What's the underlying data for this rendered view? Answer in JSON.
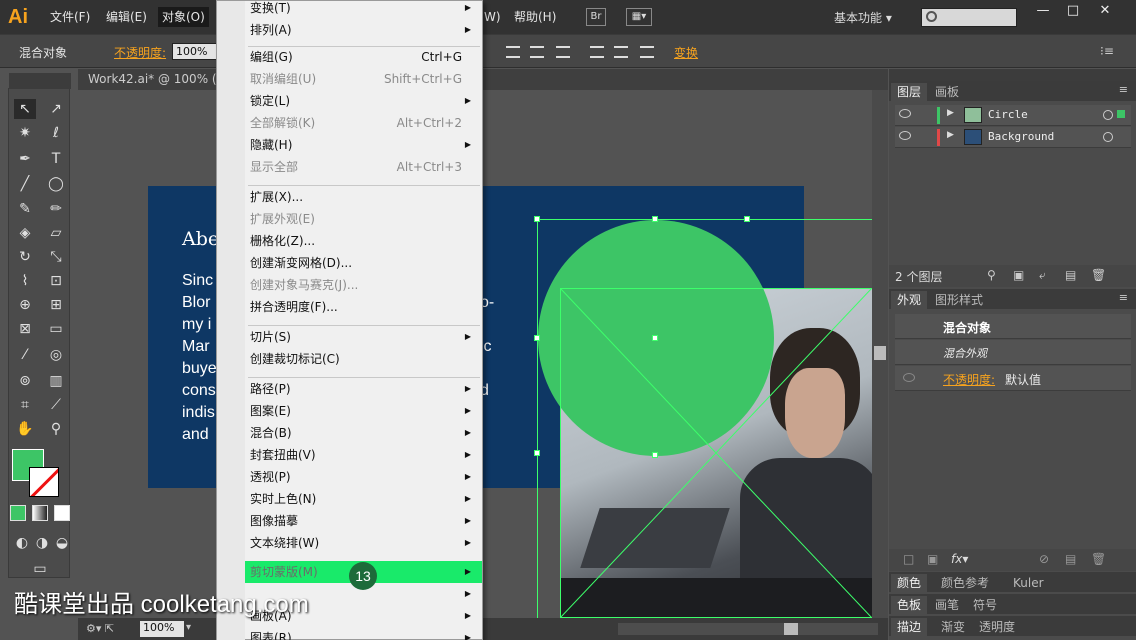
{
  "app": {
    "logo": "Ai",
    "menus": [
      "文件(F)",
      "编辑(E)",
      "对象(O)",
      "W)",
      "帮助(H)"
    ],
    "bridge": "Br",
    "workspace": "基本功能",
    "win_min": "—",
    "win_max": "□",
    "win_close": "✕"
  },
  "control": {
    "label": "混合对象",
    "opacity_label": "不透明度:",
    "opacity_value": "100%",
    "transform": "变换"
  },
  "document": {
    "tab": "Work42.ai* @ 100% (",
    "heading": "Abe",
    "lines_left": [
      "Sinc",
      "Blor",
      "my i",
      "Mar",
      "buye",
      "cons",
      "indis",
      "and"
    ],
    "lines_right": [
      "o-",
      "",
      "ic",
      "",
      "d"
    ],
    "zoom": "100%"
  },
  "menu": {
    "items": [
      {
        "label": "变换(T)",
        "shortcut": "",
        "submenu": true,
        "disabled": false
      },
      {
        "label": "排列(A)",
        "shortcut": "",
        "submenu": true,
        "disabled": false
      },
      {
        "label": "编组(G)",
        "shortcut": "Ctrl+G",
        "submenu": false,
        "disabled": false
      },
      {
        "label": "取消编组(U)",
        "shortcut": "Shift+Ctrl+G",
        "submenu": false,
        "disabled": true
      },
      {
        "label": "锁定(L)",
        "shortcut": "",
        "submenu": true,
        "disabled": false
      },
      {
        "label": "全部解锁(K)",
        "shortcut": "Alt+Ctrl+2",
        "submenu": false,
        "disabled": true
      },
      {
        "label": "隐藏(H)",
        "shortcut": "",
        "submenu": true,
        "disabled": false
      },
      {
        "label": "显示全部",
        "shortcut": "Alt+Ctrl+3",
        "submenu": false,
        "disabled": true
      },
      {
        "label": "扩展(X)...",
        "shortcut": "",
        "submenu": false,
        "disabled": false
      },
      {
        "label": "扩展外观(E)",
        "shortcut": "",
        "submenu": false,
        "disabled": true
      },
      {
        "label": "栅格化(Z)...",
        "shortcut": "",
        "submenu": false,
        "disabled": false
      },
      {
        "label": "创建渐变网格(D)...",
        "shortcut": "",
        "submenu": false,
        "disabled": false
      },
      {
        "label": "创建对象马赛克(J)...",
        "shortcut": "",
        "submenu": false,
        "disabled": true
      },
      {
        "label": "拼合透明度(F)...",
        "shortcut": "",
        "submenu": false,
        "disabled": false
      },
      {
        "label": "切片(S)",
        "shortcut": "",
        "submenu": true,
        "disabled": false
      },
      {
        "label": "创建裁切标记(C)",
        "shortcut": "",
        "submenu": false,
        "disabled": false
      },
      {
        "label": "路径(P)",
        "shortcut": "",
        "submenu": true,
        "disabled": false
      },
      {
        "label": "图案(E)",
        "shortcut": "",
        "submenu": true,
        "disabled": false
      },
      {
        "label": "混合(B)",
        "shortcut": "",
        "submenu": true,
        "disabled": false
      },
      {
        "label": "封套扭曲(V)",
        "shortcut": "",
        "submenu": true,
        "disabled": false
      },
      {
        "label": "透视(P)",
        "shortcut": "",
        "submenu": true,
        "disabled": false
      },
      {
        "label": "实时上色(N)",
        "shortcut": "",
        "submenu": true,
        "disabled": false
      },
      {
        "label": "图像描摹",
        "shortcut": "",
        "submenu": true,
        "disabled": false
      },
      {
        "label": "文本绕排(W)",
        "shortcut": "",
        "submenu": true,
        "disabled": false
      },
      {
        "label": "剪切蒙版(M)",
        "shortcut": "",
        "submenu": true,
        "disabled": false,
        "highlighted": true
      },
      {
        "label": "",
        "shortcut": "",
        "submenu": true,
        "disabled": false
      },
      {
        "label": "画板(A)",
        "shortcut": "",
        "submenu": true,
        "disabled": false
      },
      {
        "label": "图表(R)",
        "shortcut": "",
        "submenu": true,
        "disabled": false
      }
    ],
    "badge": "13"
  },
  "layers_panel": {
    "tabs": [
      "图层",
      "画板"
    ],
    "layers": [
      {
        "name": "Circle",
        "color": "#3dc566"
      },
      {
        "name": "Background",
        "color": "#e04848"
      }
    ],
    "count": "2 个图层"
  },
  "appearance_panel": {
    "tabs": [
      "外观",
      "图形样式"
    ],
    "title": "混合对象",
    "subtitle": "混合外观",
    "opacity_label": "不透明度:",
    "opacity_value": "默认值"
  },
  "bottom_panels": {
    "color_tabs": [
      "颜色",
      "颜色参考",
      "Kuler"
    ],
    "swatch_tabs": [
      "色板",
      "画笔",
      "符号"
    ],
    "stroke_tabs": [
      "描边",
      "渐变",
      "透明度"
    ]
  },
  "watermark": "酷课堂出品 coolketang.com",
  "colors": {
    "accent": "#f7a31e",
    "highlight": "#19ea6a",
    "circle_fill": "#3dc566",
    "artboard": "#0e3764"
  }
}
